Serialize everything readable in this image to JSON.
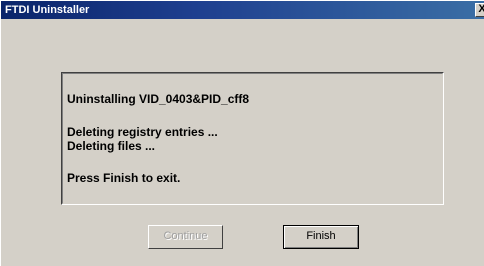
{
  "window": {
    "title": "FTDI Uninstaller",
    "close_glyph": "X"
  },
  "log": {
    "line1": "Uninstalling VID_0403&PID_cff8",
    "line2": "Deleting registry entries ...",
    "line3": "Deleting files ...",
    "line4": "Press Finish to exit."
  },
  "buttons": {
    "continue_label": "Continue",
    "finish_label": "Finish",
    "continue_enabled": false
  },
  "colors": {
    "title_bar": "#0a246a",
    "window_bg": "#d4d0c8"
  }
}
